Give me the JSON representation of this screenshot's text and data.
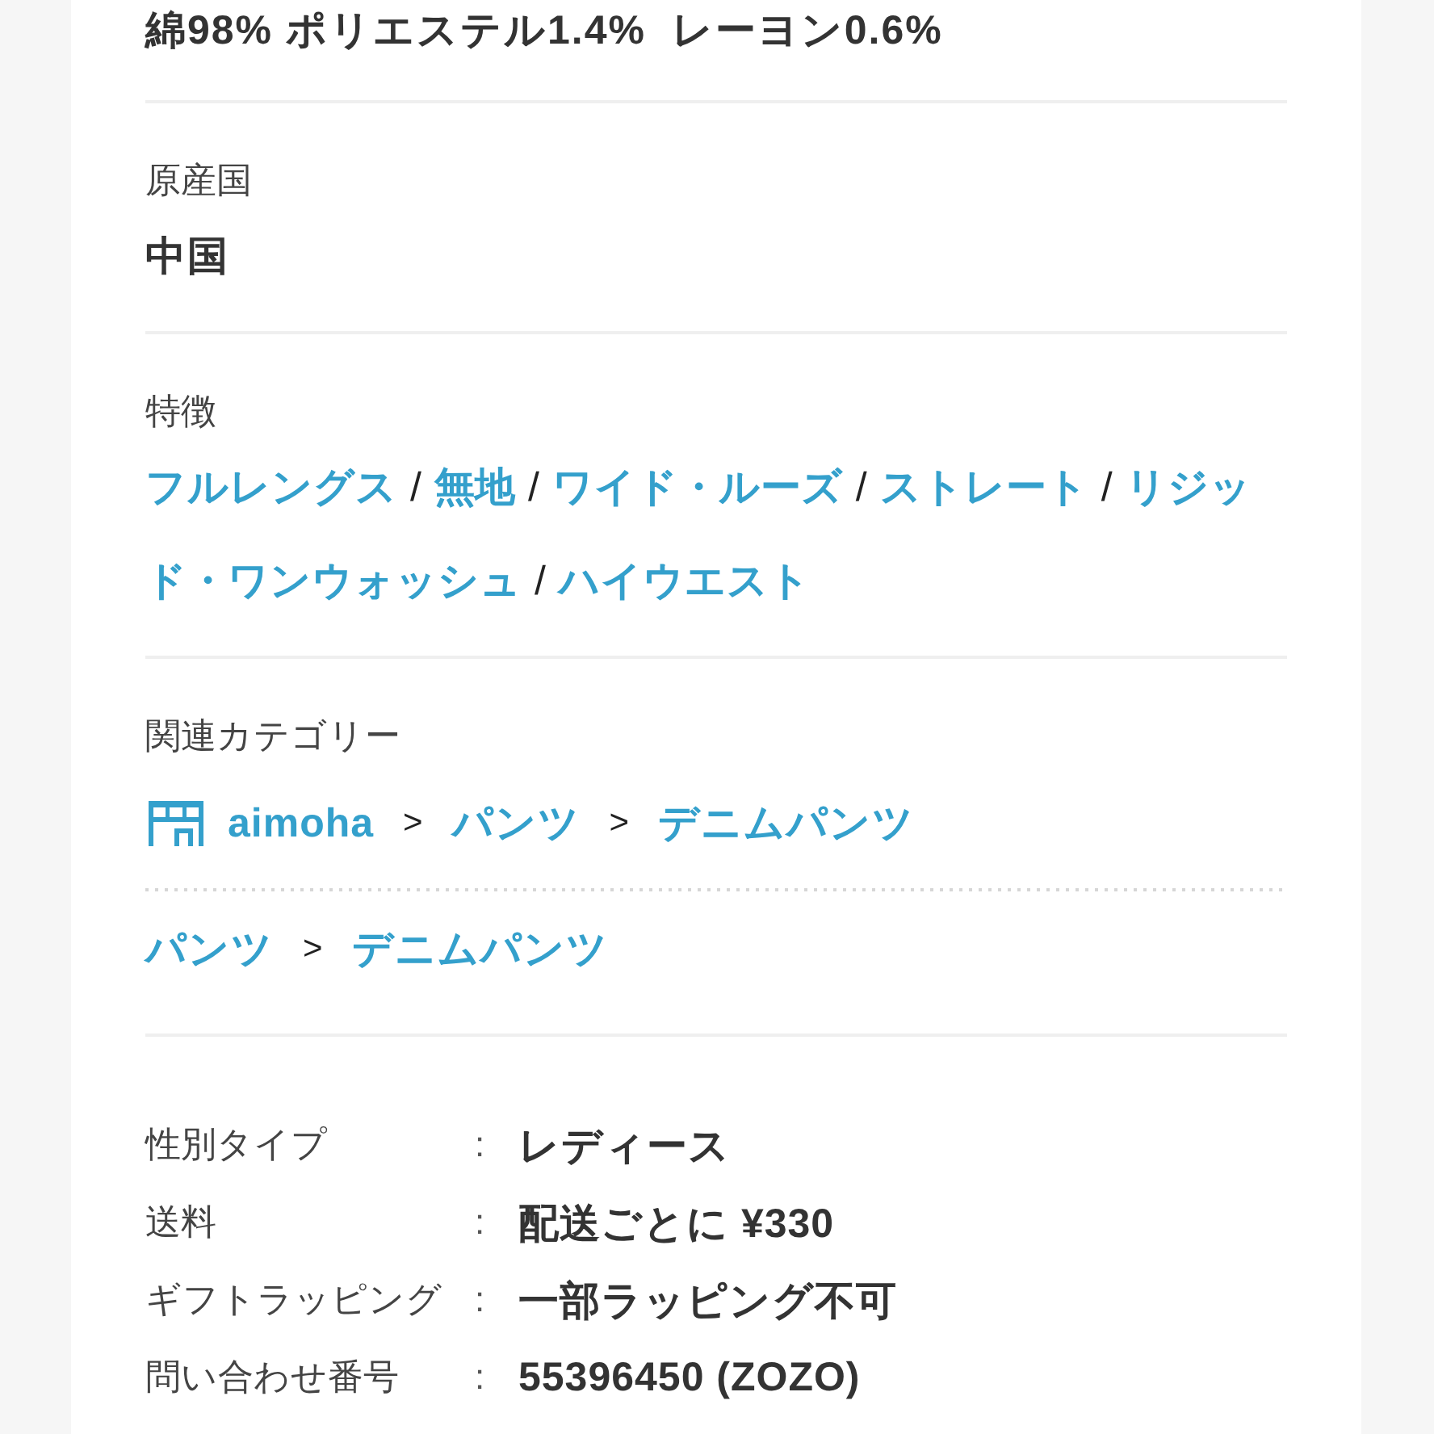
{
  "sections": [
    {
      "kind": "text",
      "value": "綿98% ポリエステル1.4%  レーヨン0.6%"
    },
    {
      "kind": "text",
      "label": "原産国",
      "value": "中国"
    },
    {
      "kind": "tags",
      "label": "特徴",
      "separator": "/",
      "items": [
        "フルレングス",
        "無地",
        "ワイド・ルーズ",
        "ストレート",
        [
          "リジッ",
          "ド・ワンウォッシュ"
        ],
        "ハイウエスト"
      ]
    },
    {
      "kind": "categories",
      "label": "関連カテゴリー",
      "paths": [
        {
          "shop_icon": true,
          "separator": ">",
          "items": [
            "aimoha",
            "パンツ",
            "デニムパンツ"
          ]
        },
        {
          "shop_icon": false,
          "separator": ">",
          "items": [
            "パンツ",
            "デニムパンツ"
          ]
        }
      ]
    },
    {
      "kind": "specs",
      "rows": [
        {
          "label": "性別タイプ",
          "separator": ":",
          "value": "レディース"
        },
        {
          "label": "送料",
          "separator": ":",
          "value": "配送ごとに ¥330"
        },
        {
          "label": "ギフトラッピング",
          "separator": ":",
          "value": "一部ラッピング不可"
        },
        {
          "label": "問い合わせ番号",
          "separator": ":",
          "value": "55396450 (ZOZO)"
        }
      ]
    }
  ]
}
